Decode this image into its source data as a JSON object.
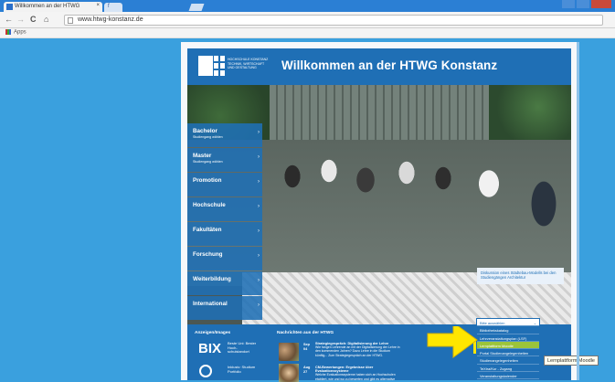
{
  "browser": {
    "tab_title": "Willkommen an der HTWG",
    "tab_close": "×",
    "tab2_label": "f",
    "url": "www.htwg-konstanz.de",
    "bookmarks_label": "Apps",
    "nav": {
      "back": "←",
      "forward": "→",
      "reload": "C",
      "home": "⌂"
    }
  },
  "site": {
    "logo_text": "HOCHSCHULE KONSTANZ TECHNIK, WIRTSCHAFT UND GESTALTUNG",
    "welcome": "Willkommen an der HTWG Konstanz",
    "photo_caption": "Diskussion eines Städtebau-Modells bei den Studiengängen Architektur",
    "menu": [
      {
        "label": "Bachelor",
        "sub": "Studiengang wählen"
      },
      {
        "label": "Master",
        "sub": "Studiengang wählen"
      },
      {
        "label": "Promotion",
        "sub": ""
      },
      {
        "label": "Hochschule",
        "sub": ""
      },
      {
        "label": "Fakultäten",
        "sub": ""
      },
      {
        "label": "Forschung",
        "sub": ""
      },
      {
        "label": "Weiterbildung",
        "sub": ""
      },
      {
        "label": "International",
        "sub": ""
      }
    ],
    "menu_arrow": "›",
    "anzeigen": {
      "title": "Anzeigen/Images",
      "bix": "BIX",
      "bix_text": "Beste Uni: Bester Hoch-schulstandort",
      "second_text": "Inklusiv: Studium Portfolio"
    },
    "news": {
      "title": "Nachrichten aus der HTWG",
      "items": [
        {
          "date": "Sep 04",
          "headline": "Strategiegespräch: Digitalisierung der Lehre",
          "text": "Wie fangen Lehrende an mit der Digitalisierung der Lehre in den kommenden Jahren? Dazu Lehre in die Studium künftig... Zum Strategiegespräch an der HTWG."
        },
        {
          "date": "Aug 27",
          "headline": "CM-Bewertungen: Ergebnisse über Evaluationssysteme",
          "text": "Welche Evaluationssysteme haben sich an Hochschulen etabliert, wie und wo zu bewerten und gibt es alternative"
        }
      ]
    },
    "quicklinks": {
      "button": "Schnellzugriff",
      "items": [
        "Bitte auswählen",
        "Bibliothekskatalog",
        "Lehrveranstaltungsplan (LSF)",
        "Lernplattform Moodle",
        "Portal Studienangelegenheiten",
        "Studienangelegenheiten",
        "TeXtra/Kur - Zugang",
        "Veranstaltungskalender"
      ],
      "selected_index": 3,
      "tooltip": "Lernplattform Moodle"
    }
  },
  "colors": {
    "page_bg": "#3aa0de",
    "brand_blue": "#1f6fb5",
    "highlight_yellow": "#ffe600",
    "selected_green": "#9cc43a"
  }
}
